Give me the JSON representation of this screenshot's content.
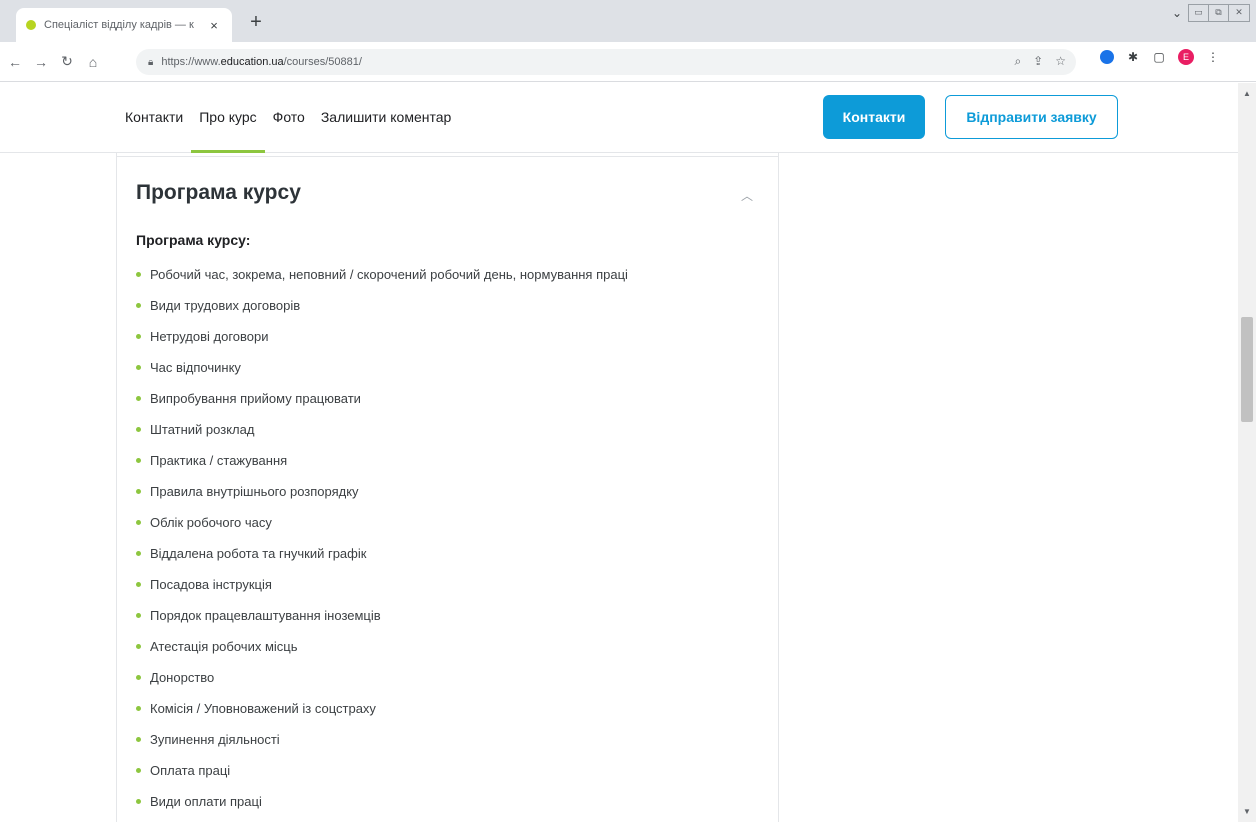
{
  "browser": {
    "tab": {
      "title": "Спеціаліст відділу кадрів — кур",
      "close": "×"
    },
    "new_tab": "+",
    "url_prefix": "https://www.",
    "url_domain": "education.ua",
    "url_path": "/courses/50881/",
    "profile_initial": "E"
  },
  "site": {
    "nav": [
      "Контакти",
      "Про курс",
      "Фото",
      "Залишити коментар"
    ],
    "active_nav": "Про курс",
    "contacts_button": "Контакти",
    "apply_button": "Відправити заявку"
  },
  "section": {
    "title": "Програма курсу",
    "subtitle": "Програма курсу:",
    "items": [
      "Робочий час, зокрема, неповний / скорочений робочий день, нормування праці",
      "Види трудових договорів",
      "Нетрудові договори",
      "Час відпочинку",
      "Випробування прийому працювати",
      "Штатний розклад",
      "Практика / стажування",
      "Правила внутрішнього розпорядку",
      "Облік робочого часу",
      "Віддалена робота та гнучкий графік",
      "Посадова інструкція",
      "Порядок працевлаштування іноземців",
      "Атестація робочих місць",
      "Донорство",
      "Комісія / Уповноважений із соцстраху",
      "Зупинення діяльності",
      "Оплата праці",
      "Види оплати праці"
    ]
  },
  "scroll_position": 0.36,
  "colors": {
    "accent_blue": "#0d9bd8",
    "accent_green": "#8dc63f",
    "heading": "#2d3338"
  }
}
